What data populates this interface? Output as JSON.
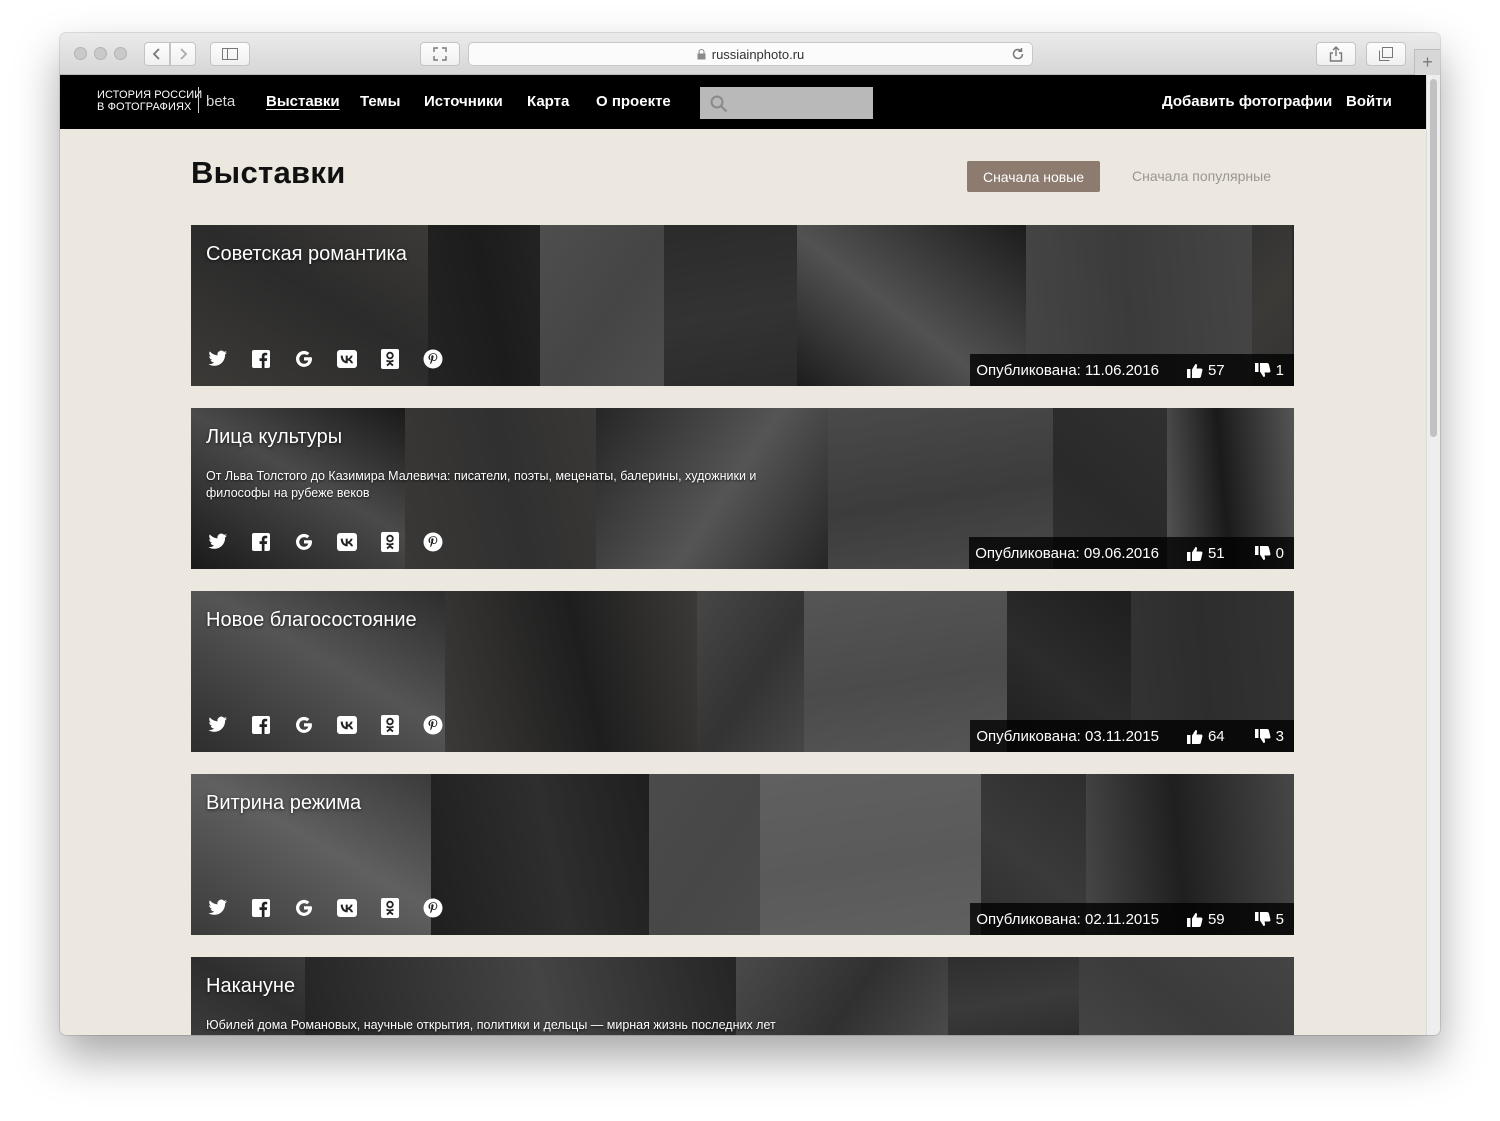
{
  "browser": {
    "url": "russiainphoto.ru"
  },
  "site": {
    "logo_line1": "ИСТОРИЯ РОССИИ",
    "logo_line2": "В ФОТОГРАФИЯХ",
    "logo_beta": "beta",
    "nav": [
      {
        "label": "Выставки",
        "active": true
      },
      {
        "label": "Темы",
        "active": false
      },
      {
        "label": "Источники",
        "active": false
      },
      {
        "label": "Карта",
        "active": false
      },
      {
        "label": "О проекте",
        "active": false
      }
    ],
    "search_placeholder": "",
    "add_photos": "Добавить фотографии",
    "login": "Войти"
  },
  "page": {
    "title": "Выставки",
    "sort_new": "Сначала новые",
    "sort_popular": "Сначала популярные"
  },
  "exhibitions": [
    {
      "title": "Советская романтика",
      "description": "",
      "published": "Опубликована: 11.06.2016",
      "likes": "57",
      "dislikes": "1",
      "tiles": [
        "#3c3a37",
        "#232323",
        "#4e4e4e",
        "#2b2b2b",
        "#1c1c1c",
        "#454545",
        "#333333",
        "#525252",
        "#3b3b3b"
      ]
    },
    {
      "title": "Лица культуры",
      "description": "От Льва Толстого до Казимира Малевича: писатели, поэты, меценаты, балерины, художники и философы на рубеже веков",
      "published": "Опубликована: 09.06.2016",
      "likes": "51",
      "dislikes": "0",
      "tiles": [
        "#1a1a1a",
        "#3a3836",
        "#262626",
        "#4a4a4a",
        "#303030",
        "#555555",
        "#3c3c3c",
        "#2a2a2a"
      ]
    },
    {
      "title": "Новое благосостояние",
      "description": "",
      "published": "Опубликована: 03.11.2015",
      "likes": "64",
      "dislikes": "3",
      "tiles": [
        "#2d2d2d",
        "#3c3a38",
        "#474747",
        "#555555",
        "#1e1e1e",
        "#333333",
        "#4b4b4b",
        "#2c2c2c"
      ]
    },
    {
      "title": "Витрина режима",
      "description": "",
      "published": "Опубликована: 02.11.2015",
      "likes": "59",
      "dislikes": "5",
      "tiles": [
        "#3a3a3a",
        "#1f1f1f",
        "#4b4b4b",
        "#606060",
        "#2e2e2e",
        "#474747",
        "#5a5a5a"
      ]
    },
    {
      "title": "Накануне",
      "description": "Юбилей дома Романовых, научные открытия, политики и дельцы — мирная жизнь последних лет",
      "published": "",
      "likes": "",
      "dislikes": "",
      "tiles": [
        "#3b3b3b",
        "#252525",
        "#4a4a4a",
        "#2e2e2e",
        "#444444",
        "#303030",
        "#3a3a3a"
      ]
    }
  ],
  "icons": {
    "share": [
      "twitter-icon",
      "facebook-icon",
      "google-icon",
      "vk-icon",
      "odnoklassniki-icon",
      "pinterest-icon"
    ],
    "like": "thumbs-up-icon",
    "dislike": "thumbs-down-icon",
    "search": "search-icon"
  }
}
